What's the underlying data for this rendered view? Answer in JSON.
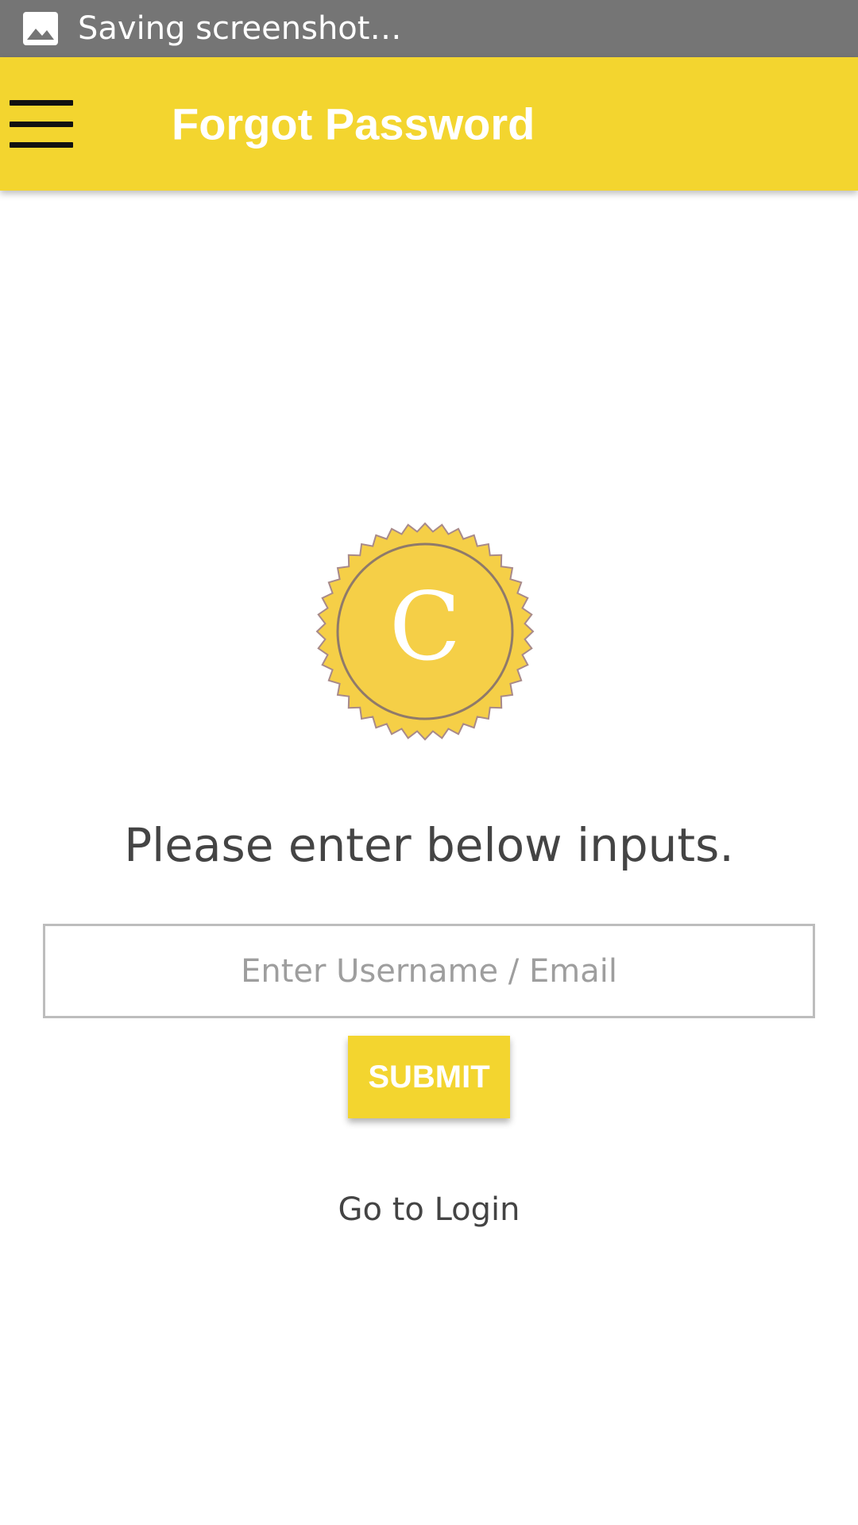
{
  "status_bar": {
    "notification_icon": "image-icon",
    "text": "Saving screenshot…"
  },
  "app_bar": {
    "menu_icon": "menu-icon",
    "title": "Forgot Password",
    "background_color": "#f3d52f"
  },
  "logo": {
    "letter": "C",
    "color": "#f5cf47"
  },
  "form": {
    "prompt": "Please enter below inputs.",
    "username_placeholder": "Enter Username / Email",
    "username_value": "",
    "submit_label": "SUBMIT"
  },
  "footer": {
    "login_link": "Go to Login"
  }
}
